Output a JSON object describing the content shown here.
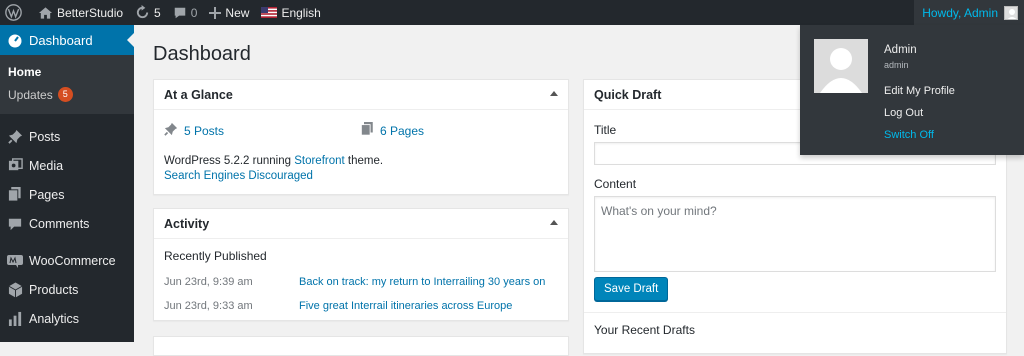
{
  "adminbar": {
    "site_name": "BetterStudio",
    "updates_count": "5",
    "comments_count": "0",
    "new_label": "New",
    "language_label": "English",
    "greeting": "Howdy, Admin"
  },
  "sidebar": {
    "dashboard_label": "Dashboard",
    "submenu": [
      {
        "label": "Home"
      },
      {
        "label": "Updates",
        "badge": "5"
      }
    ],
    "items": [
      {
        "label": "Posts",
        "icon": "pin-icon"
      },
      {
        "label": "Media",
        "icon": "media-icon"
      },
      {
        "label": "Pages",
        "icon": "pages-icon"
      },
      {
        "label": "Comments",
        "icon": "comment-icon"
      },
      {
        "label": "WooCommerce",
        "icon": "woocommerce-icon"
      },
      {
        "label": "Products",
        "icon": "box-icon"
      },
      {
        "label": "Analytics",
        "icon": "bar-chart-icon"
      }
    ]
  },
  "page": {
    "title": "Dashboard"
  },
  "at_a_glance": {
    "title": "At a Glance",
    "posts": "5 Posts",
    "pages": "6 Pages",
    "version_text": "WordPress 5.2.2 running ",
    "theme_name": "Storefront",
    "theme_suffix": " theme.",
    "search_engines": "Search Engines Discouraged"
  },
  "activity": {
    "title": "Activity",
    "subtitle": "Recently Published",
    "rows": [
      {
        "date": "Jun 23rd, 9:39 am",
        "title": "Back on track: my return to Interrailing 30 years on"
      },
      {
        "date": "Jun 23rd, 9:33 am",
        "title": "Five great Interrail itineraries across Europe"
      }
    ]
  },
  "quick_draft": {
    "title": "Quick Draft",
    "title_label": "Title",
    "content_label": "Content",
    "content_placeholder": "What's on your mind?",
    "save_button": "Save Draft",
    "recent_drafts": "Your Recent Drafts"
  },
  "user_dropdown": {
    "display_name": "Admin",
    "username": "admin",
    "edit_profile": "Edit My Profile",
    "log_out": "Log Out",
    "switch_off": "Switch Off"
  },
  "colors": {
    "accent": "#0073aa",
    "adminbar_bg": "#23282d",
    "badge": "#d54e21",
    "link_highlight": "#00b9eb"
  }
}
